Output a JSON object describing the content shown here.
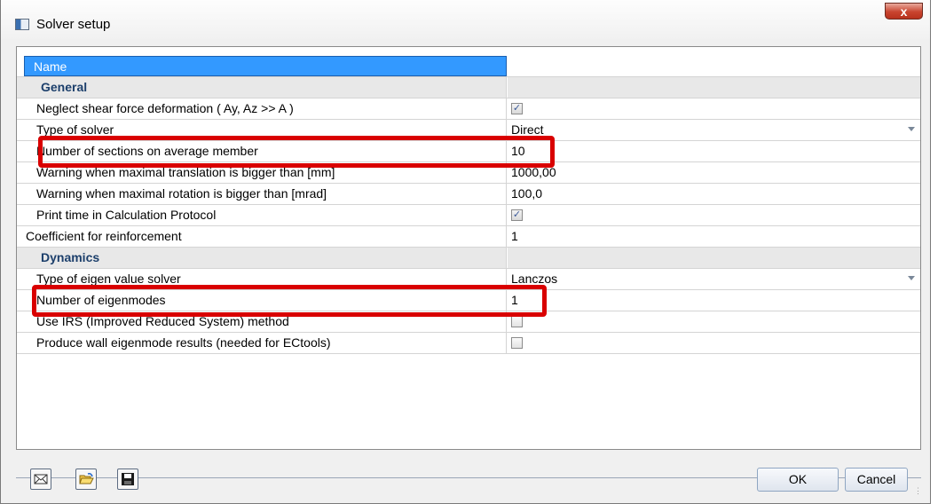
{
  "window": {
    "title": "Solver setup",
    "close_glyph": "x"
  },
  "grid": {
    "header_label": "Name",
    "rows": [
      {
        "kind": "category",
        "label": "General",
        "toggle": "⊟"
      },
      {
        "kind": "prop",
        "label": "Neglect shear force deformation ( Ay, Az >> A )",
        "type": "checkbox",
        "checked": true
      },
      {
        "kind": "prop",
        "label": "Type of solver",
        "type": "dropdown",
        "value": "Direct"
      },
      {
        "kind": "prop",
        "label": "Number of sections on average member",
        "type": "text",
        "value": "10",
        "highlighted": true
      },
      {
        "kind": "prop",
        "label": "Warning when maximal translation is bigger than [mm]",
        "type": "text",
        "value": "1000,00"
      },
      {
        "kind": "prop",
        "label": "Warning when maximal rotation is bigger than [mrad]",
        "type": "text",
        "value": "100,0"
      },
      {
        "kind": "prop",
        "label": "Print time in Calculation Protocol",
        "type": "checkbox",
        "checked": true
      },
      {
        "kind": "top",
        "label": "Coefficient for reinforcement",
        "type": "text",
        "value": "1"
      },
      {
        "kind": "category",
        "label": "Dynamics",
        "toggle": "⊟"
      },
      {
        "kind": "prop",
        "label": "Type of eigen value solver",
        "type": "dropdown",
        "value": "Lanczos"
      },
      {
        "kind": "prop",
        "label": "Number of eigenmodes",
        "type": "text",
        "value": "1",
        "highlighted": true
      },
      {
        "kind": "prop",
        "label": "Use IRS (Improved Reduced System) method",
        "type": "checkbox",
        "checked": false
      },
      {
        "kind": "prop",
        "label": "Produce wall eigenmode results (needed for ECtools)",
        "type": "checkbox",
        "checked": false
      }
    ]
  },
  "toolbar": {
    "buttons": [
      {
        "name": "default-settings-button",
        "icon": "envelope-icon"
      },
      {
        "name": "open-button",
        "icon": "folder-open-icon"
      },
      {
        "name": "save-button",
        "icon": "floppy-disk-icon"
      }
    ]
  },
  "footer": {
    "ok_label": "OK",
    "cancel_label": "Cancel"
  },
  "colors": {
    "highlight": "#d90000",
    "selected_header": "#3399ff",
    "category_text": "#1c3f6b"
  }
}
